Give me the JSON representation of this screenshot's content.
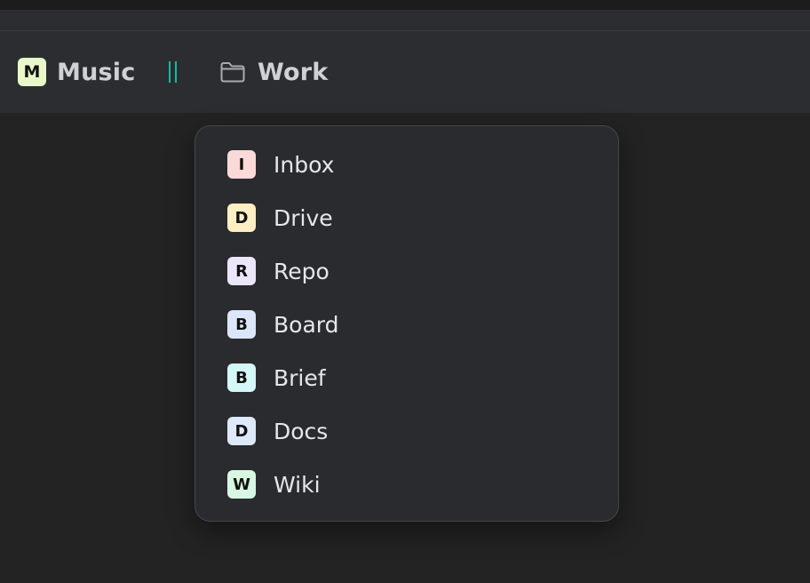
{
  "breadcrumb": {
    "workspace": {
      "badge": "M",
      "label": "Music",
      "badge_color": "#e8f8c8"
    },
    "folder": {
      "label": "Work",
      "icon": "folder-icon"
    },
    "separator_color": "#15b8a6"
  },
  "menu": {
    "items": [
      {
        "badge": "I",
        "label": "Inbox",
        "color": "#fcd9d9"
      },
      {
        "badge": "D",
        "label": "Drive",
        "color": "#fdeec3"
      },
      {
        "badge": "R",
        "label": "Repo",
        "color": "#ece6fb"
      },
      {
        "badge": "B",
        "label": "Board",
        "color": "#dbe6fb"
      },
      {
        "badge": "B",
        "label": "Brief",
        "color": "#d4f7f8"
      },
      {
        "badge": "D",
        "label": "Docs",
        "color": "#dee8fb"
      },
      {
        "badge": "W",
        "label": "Wiki",
        "color": "#d7f7e2"
      }
    ]
  }
}
